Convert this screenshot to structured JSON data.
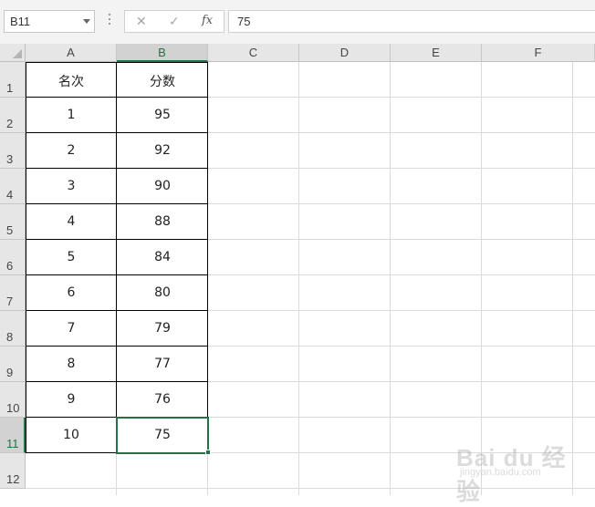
{
  "formula_bar": {
    "name_box": "B11",
    "cancel_icon": "✕",
    "enter_icon": "✓",
    "function_label": "fx",
    "formula_value": "75"
  },
  "columns": [
    "A",
    "B",
    "C",
    "D",
    "E",
    "F"
  ],
  "rows": [
    "1",
    "2",
    "3",
    "4",
    "5",
    "6",
    "7",
    "8",
    "9",
    "10",
    "11",
    "12"
  ],
  "table": {
    "header": [
      "名次",
      "分数"
    ],
    "data": [
      [
        "1",
        "95"
      ],
      [
        "2",
        "92"
      ],
      [
        "3",
        "90"
      ],
      [
        "4",
        "88"
      ],
      [
        "5",
        "84"
      ],
      [
        "6",
        "80"
      ],
      [
        "7",
        "79"
      ],
      [
        "8",
        "77"
      ],
      [
        "9",
        "76"
      ],
      [
        "10",
        "75"
      ]
    ]
  },
  "selection": {
    "cell": "B11",
    "accent": "#217346"
  },
  "watermark": {
    "main": "Bai du 经验",
    "sub": "jingyan.baidu.com"
  }
}
